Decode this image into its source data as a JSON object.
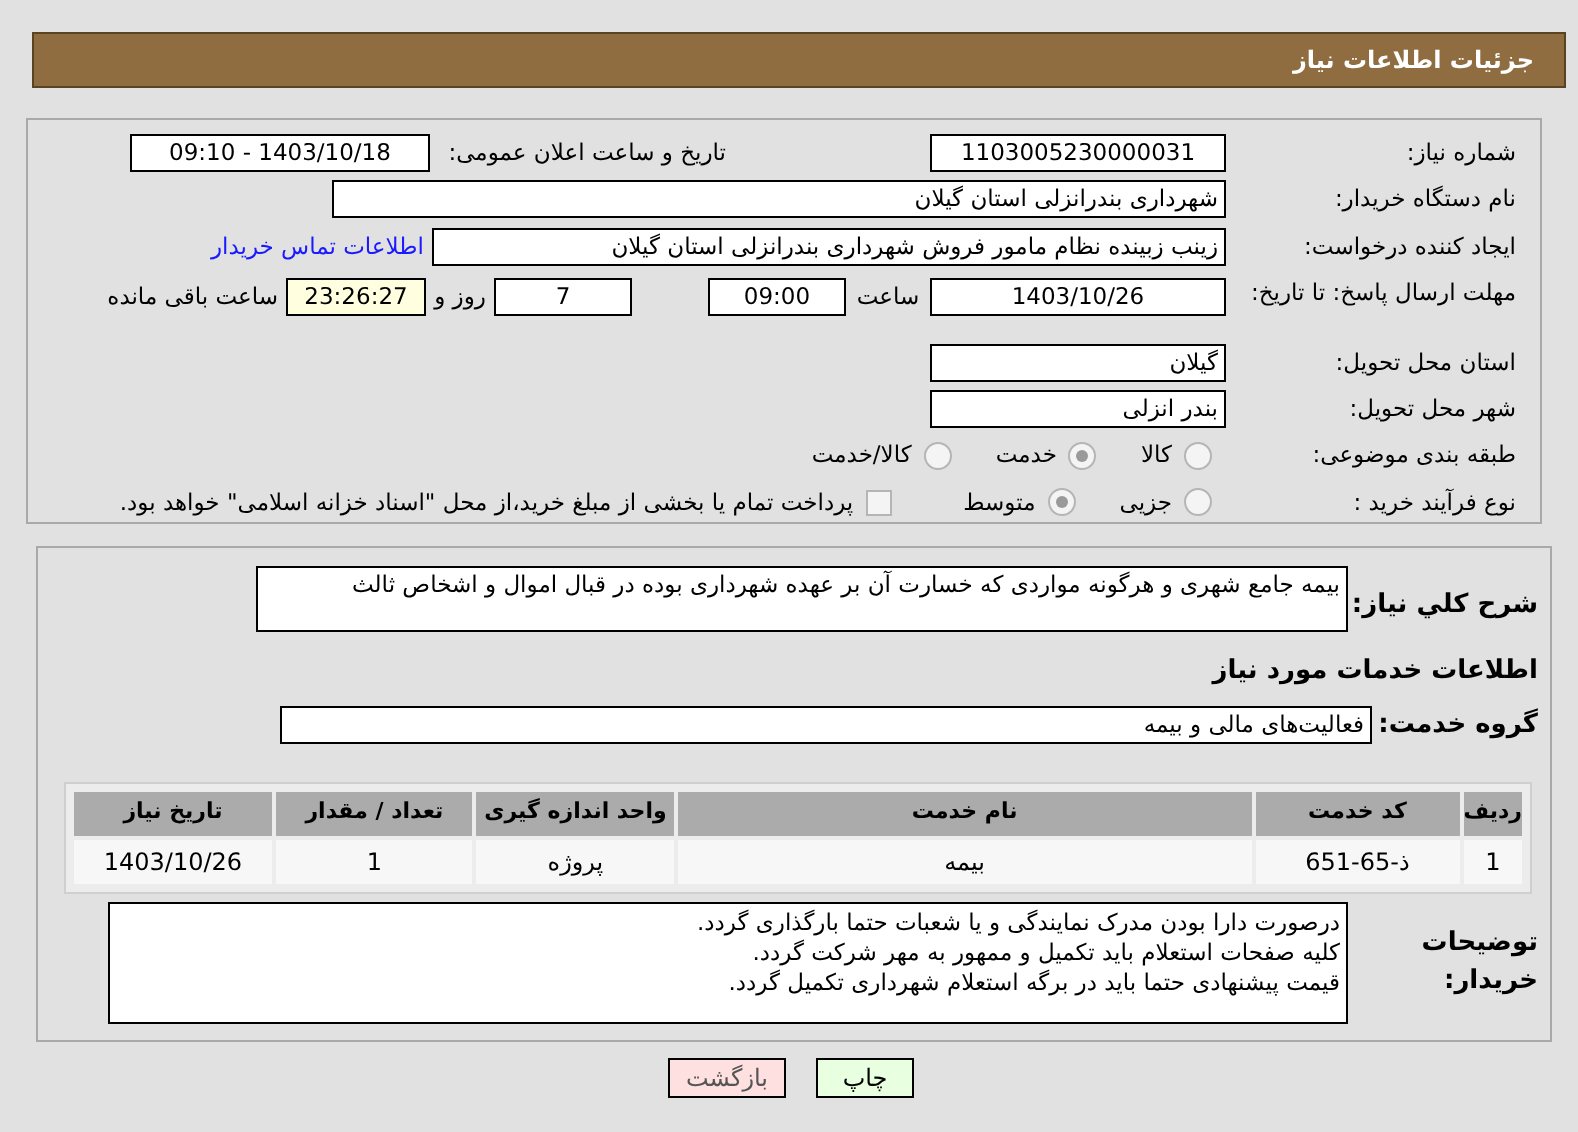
{
  "header": {
    "title": "جزئیات اطلاعات نیاز"
  },
  "info": {
    "need_number": {
      "label": "شماره نیاز:",
      "value": "1103005230000031"
    },
    "announce": {
      "label": "تاریخ و ساعت اعلان عمومی:",
      "value": "1403/10/18 - 09:10"
    },
    "buyer": {
      "label": "نام دستگاه خریدار:",
      "value": "شهرداری بندرانزلی استان گیلان"
    },
    "creator": {
      "label": "ایجاد کننده درخواست:",
      "value": "زینب زبینده نظام مامور فروش شهرداری بندرانزلی استان گیلان",
      "link": "اطلاعات تماس خریدار"
    },
    "deadline": {
      "label": "مهلت ارسال پاسخ: تا تاریخ:",
      "date": "1403/10/26",
      "time_label": "ساعت",
      "time": "09:00",
      "days": "7",
      "days_label": "روز و",
      "remaining": "23:26:27",
      "remaining_label": "ساعت باقی مانده"
    },
    "province": {
      "label": "استان محل تحویل:",
      "value": "گیلان"
    },
    "city": {
      "label": "شهر محل تحویل:",
      "value": "بندر انزلی"
    },
    "category": {
      "label": "طبقه بندی موضوعی:",
      "options": [
        {
          "label": "کالا",
          "selected": false
        },
        {
          "label": "خدمت",
          "selected": true
        },
        {
          "label": "کالا/خدمت",
          "selected": false
        }
      ]
    },
    "process": {
      "label": "نوع فرآیند خرید :",
      "options": [
        {
          "label": "جزیی",
          "selected": false
        },
        {
          "label": "متوسط",
          "selected": true
        }
      ],
      "payment": {
        "checked": false,
        "label": "پرداخت تمام یا بخشی از مبلغ خرید،از محل \"اسناد خزانه اسلامی\" خواهد بود."
      }
    }
  },
  "details": {
    "summary": {
      "label": "شرح کلي نیاز:",
      "value": "بیمه جامع شهری و هرگونه مواردی که خسارت آن بر عهده شهرداری بوده در قبال اموال و اشخاص ثالث"
    },
    "services_heading": "اطلاعات خدمات مورد نیاز",
    "group": {
      "label": "گروه خدمت:",
      "value": "فعالیت‌های مالی و بیمه"
    },
    "table": {
      "columns": [
        "ردیف",
        "کد خدمت",
        "نام خدمت",
        "واحد اندازه گیری",
        "تعداد / مقدار",
        "تاریخ نیاز"
      ],
      "rows": [
        [
          "1",
          "ذ-65-651",
          "بیمه",
          "پروژه",
          "1",
          "1403/10/26"
        ]
      ]
    },
    "notes": {
      "label": "توضیحات خریدار:",
      "lines": [
        "درصورت دارا بودن مدرک نمایندگی و یا شعبات حتما بارگذاری گردد.",
        "کلیه صفحات استعلام باید تکمیل و ممهور به مهر شرکت گردد.",
        "قیمت پیشنهادی حتما باید در برگه استعلام شهرداری تکمیل گردد."
      ]
    }
  },
  "buttons": [
    {
      "label": "چاپ",
      "kind": "print"
    },
    {
      "label": "بازگشت",
      "kind": "back"
    }
  ]
}
